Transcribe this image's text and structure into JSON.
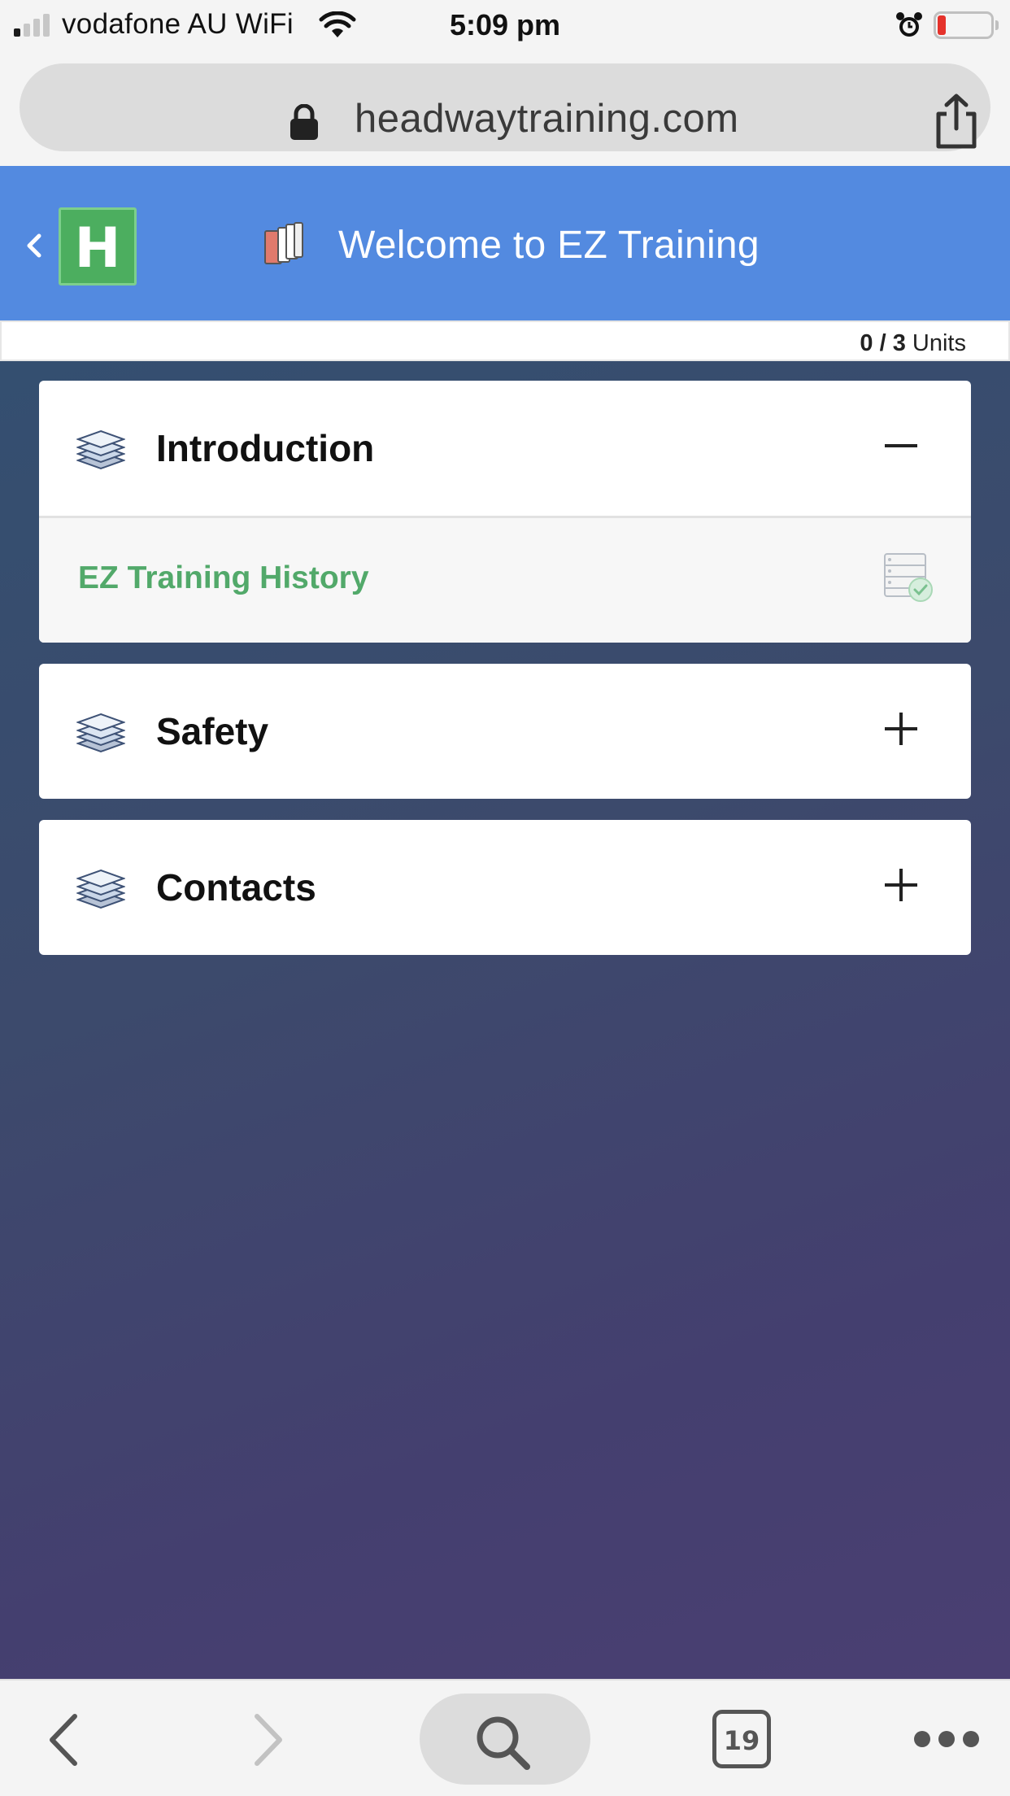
{
  "status_bar": {
    "carrier": "vodafone AU WiFi",
    "time": "5:09 pm",
    "signal_bars_active": 1,
    "battery_level": 0.15,
    "icons": [
      "wifi-icon",
      "alarm-icon",
      "battery-icon"
    ]
  },
  "browser": {
    "url": "headwaytraining.com",
    "icons": [
      "lock-icon",
      "share-icon"
    ]
  },
  "header": {
    "logo_letter": "H",
    "title": "Welcome to EZ Training",
    "icons": [
      "back-chevron-icon",
      "books-icon"
    ]
  },
  "progress": {
    "completed": "0",
    "separator": "/",
    "total": "3",
    "label": "Units"
  },
  "modules": [
    {
      "title": "Introduction",
      "expanded": true,
      "toggle": "collapse-minus-icon",
      "units": [
        {
          "title": "EZ Training History",
          "status_icon": "unit-checklist-complete-icon"
        }
      ]
    },
    {
      "title": "Safety",
      "expanded": false,
      "toggle": "expand-plus-icon",
      "units": []
    },
    {
      "title": "Contacts",
      "expanded": false,
      "toggle": "expand-plus-icon",
      "units": []
    }
  ],
  "toolbar": {
    "tab_count": "19",
    "icons": [
      "back-arrow-icon",
      "forward-arrow-icon",
      "search-icon",
      "tabs-icon",
      "more-icon"
    ]
  },
  "colors": {
    "header_blue": "#538ae0",
    "logo_green": "#4cae5f",
    "unit_green": "#52a96a",
    "background_start": "#344f70",
    "background_end": "#4a3f72",
    "battery_red": "#e5322b"
  }
}
